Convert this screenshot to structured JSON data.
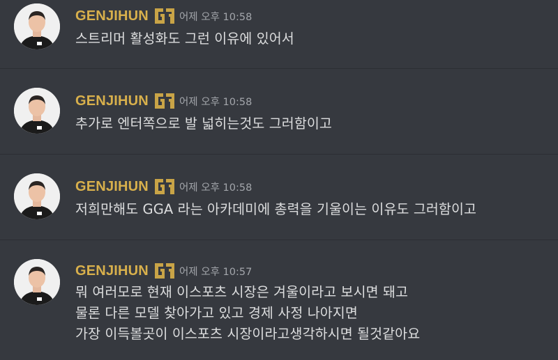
{
  "messages": [
    {
      "username": "GENJIHUN",
      "timestamp": "어제 오후 10:58",
      "lines": [
        "스트리머 활성화도 그런 이유에 있어서"
      ]
    },
    {
      "username": "GENJIHUN",
      "timestamp": "어제 오후 10:58",
      "lines": [
        "추가로 엔터쪽으로 발 넓히는것도 그러함이고"
      ]
    },
    {
      "username": "GENJIHUN",
      "timestamp": "어제 오후 10:58",
      "lines": [
        "저희만해도 GGA 라는 아카데미에 총력을 기울이는 이유도 그러함이고"
      ]
    },
    {
      "username": "GENJIHUN",
      "timestamp": "어제 오후 10:57",
      "lines": [
        "뭐 여러모로 현재 이스포츠 시장은 겨울이라고 보시면 돼고",
        "물론 다른 모델 찾아가고 있고 경제 사정 나아지면",
        "가장 이득볼곳이 이스포츠 시장이라고생각하시면 될것같아요"
      ]
    }
  ],
  "colors": {
    "background": "#36393f",
    "username": "#d8b04c",
    "timestamp": "#a3a6ab",
    "text": "#dcddde"
  },
  "icons": {
    "badge": "gen-g-logo-icon",
    "avatar": "user-avatar"
  }
}
